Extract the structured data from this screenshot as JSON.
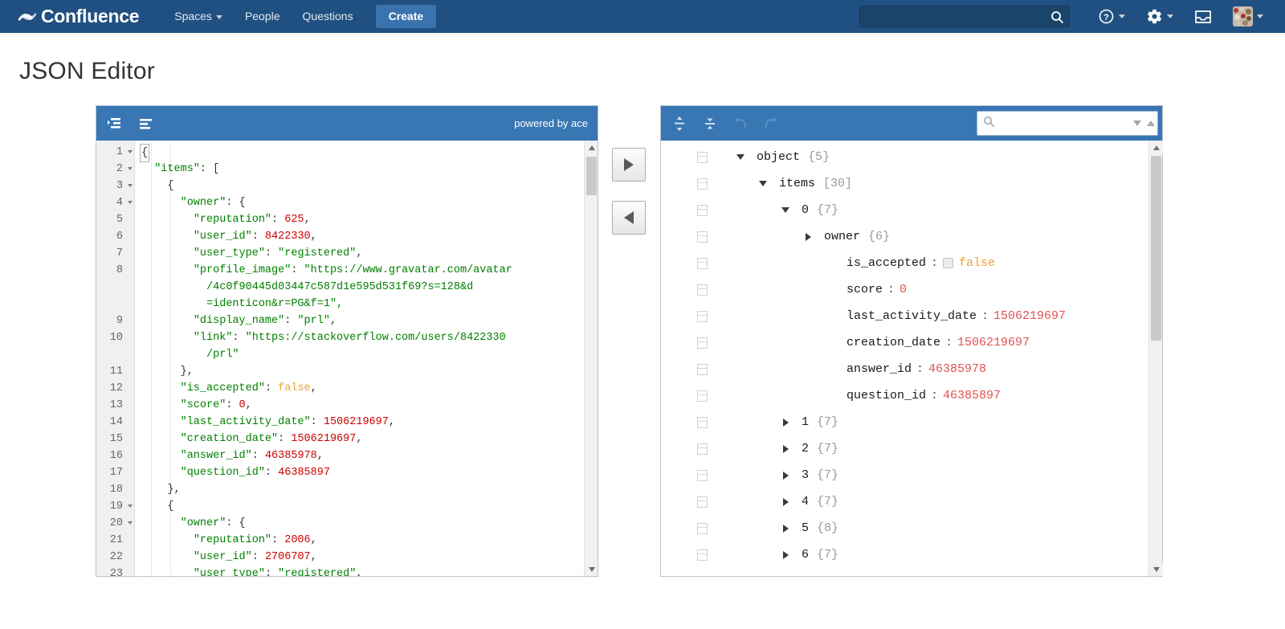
{
  "nav": {
    "logo_text": "Confluence",
    "logo_icon": "confluence-logo-icon",
    "items": [
      {
        "label": "Spaces",
        "has_caret": true
      },
      {
        "label": "People",
        "has_caret": false
      },
      {
        "label": "Questions",
        "has_caret": false
      }
    ],
    "create_label": "Create",
    "search_value": "",
    "search_placeholder": "",
    "icons": [
      "search-icon",
      "help-icon",
      "settings-gear-icon",
      "notifications-inbox-icon",
      "user-avatar"
    ]
  },
  "page": {
    "title": "JSON Editor"
  },
  "editor": {
    "menu": {
      "format_label": "format-json-icon",
      "compact_label": "compact-json-icon",
      "powered_by": "powered by ace"
    },
    "line_numbers": [
      "1",
      "2",
      "3",
      "4",
      "5",
      "6",
      "7",
      "8",
      "",
      "",
      "9",
      "10",
      "",
      "11",
      "12",
      "13",
      "14",
      "15",
      "16",
      "17",
      "18",
      "19",
      "20",
      "21",
      "22",
      "23"
    ],
    "fold_lines": [
      1,
      2,
      3,
      4,
      19,
      20
    ],
    "lines": [
      {
        "indent": 0,
        "tokens": [
          {
            "t": "{",
            "c": "p cursor-box"
          }
        ]
      },
      {
        "indent": 2,
        "tokens": [
          {
            "t": "\"items\"",
            "c": "k"
          },
          {
            "t": ": [",
            "c": "p"
          }
        ]
      },
      {
        "indent": 4,
        "tokens": [
          {
            "t": "{",
            "c": "p"
          }
        ]
      },
      {
        "indent": 6,
        "tokens": [
          {
            "t": "\"owner\"",
            "c": "k"
          },
          {
            "t": ": {",
            "c": "p"
          }
        ]
      },
      {
        "indent": 8,
        "tokens": [
          {
            "t": "\"reputation\"",
            "c": "k"
          },
          {
            "t": ": ",
            "c": "p"
          },
          {
            "t": "625",
            "c": "num"
          },
          {
            "t": ",",
            "c": "p"
          }
        ]
      },
      {
        "indent": 8,
        "tokens": [
          {
            "t": "\"user_id\"",
            "c": "k"
          },
          {
            "t": ": ",
            "c": "p"
          },
          {
            "t": "8422330",
            "c": "num"
          },
          {
            "t": ",",
            "c": "p"
          }
        ]
      },
      {
        "indent": 8,
        "tokens": [
          {
            "t": "\"user_type\"",
            "c": "k"
          },
          {
            "t": ": ",
            "c": "p"
          },
          {
            "t": "\"registered\"",
            "c": "k"
          },
          {
            "t": ",",
            "c": "p"
          }
        ]
      },
      {
        "indent": 8,
        "tokens": [
          {
            "t": "\"profile_image\"",
            "c": "k"
          },
          {
            "t": ": ",
            "c": "p"
          },
          {
            "t": "\"https://www.gravatar.com/avatar",
            "c": "k"
          }
        ]
      },
      {
        "indent": 10,
        "tokens": [
          {
            "t": "/4c0f90445d03447c587d1e595d531f69?s=128&d",
            "c": "k"
          }
        ]
      },
      {
        "indent": 10,
        "tokens": [
          {
            "t": "=identicon&r=PG&f=1\",",
            "c": "k"
          }
        ]
      },
      {
        "indent": 8,
        "tokens": [
          {
            "t": "\"display_name\"",
            "c": "k"
          },
          {
            "t": ": ",
            "c": "p"
          },
          {
            "t": "\"prl\"",
            "c": "k"
          },
          {
            "t": ",",
            "c": "p"
          }
        ]
      },
      {
        "indent": 8,
        "tokens": [
          {
            "t": "\"link\"",
            "c": "k"
          },
          {
            "t": ": ",
            "c": "p"
          },
          {
            "t": "\"https://stackoverflow.com/users/8422330",
            "c": "k"
          }
        ]
      },
      {
        "indent": 10,
        "tokens": [
          {
            "t": "/prl\"",
            "c": "k"
          }
        ]
      },
      {
        "indent": 6,
        "tokens": [
          {
            "t": "},",
            "c": "p"
          }
        ]
      },
      {
        "indent": 6,
        "tokens": [
          {
            "t": "\"is_accepted\"",
            "c": "k"
          },
          {
            "t": ": ",
            "c": "p"
          },
          {
            "t": "false",
            "c": "bool"
          },
          {
            "t": ",",
            "c": "p"
          }
        ]
      },
      {
        "indent": 6,
        "tokens": [
          {
            "t": "\"score\"",
            "c": "k"
          },
          {
            "t": ": ",
            "c": "p"
          },
          {
            "t": "0",
            "c": "num"
          },
          {
            "t": ",",
            "c": "p"
          }
        ]
      },
      {
        "indent": 6,
        "tokens": [
          {
            "t": "\"last_activity_date\"",
            "c": "k"
          },
          {
            "t": ": ",
            "c": "p"
          },
          {
            "t": "1506219697",
            "c": "num"
          },
          {
            "t": ",",
            "c": "p"
          }
        ]
      },
      {
        "indent": 6,
        "tokens": [
          {
            "t": "\"creation_date\"",
            "c": "k"
          },
          {
            "t": ": ",
            "c": "p"
          },
          {
            "t": "1506219697",
            "c": "num"
          },
          {
            "t": ",",
            "c": "p"
          }
        ]
      },
      {
        "indent": 6,
        "tokens": [
          {
            "t": "\"answer_id\"",
            "c": "k"
          },
          {
            "t": ": ",
            "c": "p"
          },
          {
            "t": "46385978",
            "c": "num"
          },
          {
            "t": ",",
            "c": "p"
          }
        ]
      },
      {
        "indent": 6,
        "tokens": [
          {
            "t": "\"question_id\"",
            "c": "k"
          },
          {
            "t": ": ",
            "c": "p"
          },
          {
            "t": "46385897",
            "c": "num"
          }
        ]
      },
      {
        "indent": 4,
        "tokens": [
          {
            "t": "},",
            "c": "p"
          }
        ]
      },
      {
        "indent": 4,
        "tokens": [
          {
            "t": "{",
            "c": "p"
          }
        ]
      },
      {
        "indent": 6,
        "tokens": [
          {
            "t": "\"owner\"",
            "c": "k"
          },
          {
            "t": ": {",
            "c": "p"
          }
        ]
      },
      {
        "indent": 8,
        "tokens": [
          {
            "t": "\"reputation\"",
            "c": "k"
          },
          {
            "t": ": ",
            "c": "p"
          },
          {
            "t": "2006",
            "c": "num"
          },
          {
            "t": ",",
            "c": "p"
          }
        ]
      },
      {
        "indent": 8,
        "tokens": [
          {
            "t": "\"user_id\"",
            "c": "k"
          },
          {
            "t": ": ",
            "c": "p"
          },
          {
            "t": "2706707",
            "c": "num"
          },
          {
            "t": ",",
            "c": "p"
          }
        ]
      },
      {
        "indent": 8,
        "tokens": [
          {
            "t": "\"user_type\"",
            "c": "k"
          },
          {
            "t": ": ",
            "c": "p"
          },
          {
            "t": "\"registered\"",
            "c": "k"
          },
          {
            "t": ",",
            "c": "p"
          }
        ]
      }
    ]
  },
  "transfer": {
    "to_tree_label": "transfer-right-button",
    "to_code_label": "transfer-left-button"
  },
  "tree": {
    "menu": {
      "expand_all": "expand-all-icon",
      "collapse_all": "collapse-all-icon",
      "undo": "undo-icon",
      "redo": "redo-icon"
    },
    "search_value": "",
    "search_placeholder": "",
    "rows": [
      {
        "depth": 0,
        "expand": "open",
        "key": "object",
        "count": "{5}"
      },
      {
        "depth": 1,
        "expand": "open",
        "key": "items",
        "count": "[30]"
      },
      {
        "depth": 2,
        "expand": "open",
        "key": "0",
        "count": "{7}"
      },
      {
        "depth": 3,
        "expand": "closed",
        "key": "owner",
        "count": "{6}"
      },
      {
        "depth": 4,
        "expand": "none",
        "key": "is_accepted",
        "value": "false",
        "vtype": "bool",
        "checkbox": true
      },
      {
        "depth": 4,
        "expand": "none",
        "key": "score",
        "value": "0",
        "vtype": "num"
      },
      {
        "depth": 4,
        "expand": "none",
        "key": "last_activity_date",
        "value": "1506219697",
        "vtype": "num"
      },
      {
        "depth": 4,
        "expand": "none",
        "key": "creation_date",
        "value": "1506219697",
        "vtype": "num"
      },
      {
        "depth": 4,
        "expand": "none",
        "key": "answer_id",
        "value": "46385978",
        "vtype": "num"
      },
      {
        "depth": 4,
        "expand": "none",
        "key": "question_id",
        "value": "46385897",
        "vtype": "num"
      },
      {
        "depth": 2,
        "expand": "closed",
        "key": "1",
        "count": "{7}"
      },
      {
        "depth": 2,
        "expand": "closed",
        "key": "2",
        "count": "{7}"
      },
      {
        "depth": 2,
        "expand": "closed",
        "key": "3",
        "count": "{7}"
      },
      {
        "depth": 2,
        "expand": "closed",
        "key": "4",
        "count": "{7}"
      },
      {
        "depth": 2,
        "expand": "closed",
        "key": "5",
        "count": "{8}"
      },
      {
        "depth": 2,
        "expand": "closed",
        "key": "6",
        "count": "{7}"
      }
    ]
  },
  "colors": {
    "nav_bg": "#205081",
    "panel_header": "#3876b4",
    "string": "#008000",
    "number": "#cc0000",
    "boolean": "#e8a33d",
    "tree_number": "#e05252",
    "tree_boolean": "#f0a030"
  }
}
